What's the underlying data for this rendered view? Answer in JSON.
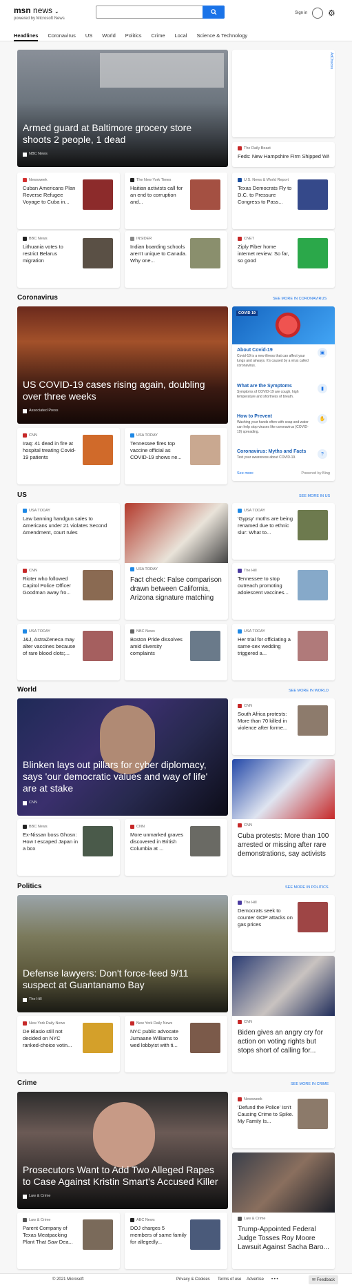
{
  "header": {
    "brand": "msn",
    "section": "news",
    "powered": "powered by Microsoft News",
    "signin": "Sign in"
  },
  "nav": [
    "Headlines",
    "Coronavirus",
    "US",
    "World",
    "Politics",
    "Crime",
    "Local",
    "Science & Technology"
  ],
  "ad": {
    "label": "AdChoices"
  },
  "hero1": {
    "title": "Armed guard at Baltimore grocery store shoots 2 people, 1 dead",
    "source": "NBC News"
  },
  "beast": {
    "source": "The Daily Beast",
    "title": "Feds: New Hampshire Firm Shipped WM..."
  },
  "row1": [
    {
      "source": "Newsweek",
      "title": "Cuban Americans Plan Reverse Refugee Voyage to Cuba in...",
      "color": "#d32f2f"
    },
    {
      "source": "The New York Times",
      "title": "Haitian activists call for an end to corruption and...",
      "color": "#222"
    },
    {
      "source": "U.S. News & World Report",
      "title": "Texas Democrats Fly to D.C. to Pressure Congress to Pass...",
      "color": "#1a4fa0"
    }
  ],
  "row2": [
    {
      "source": "BBC News",
      "title": "Lithuania votes to restrict Belarus migration",
      "color": "#222"
    },
    {
      "source": "INSIDER",
      "title": "Indian boarding schools aren't unique to Canada. Why one...",
      "color": "#888"
    },
    {
      "source": "CNET",
      "title": "Ziply Fiber home internet review: So far, so good",
      "color": "#c62828"
    }
  ],
  "corona": {
    "heading": "Coronavirus",
    "more": "SEE MORE IN CORONAVIRUS",
    "hero": {
      "title": "US COVID-19 cases rising again, doubling over three weeks",
      "source": "Associated Press"
    },
    "cards": [
      {
        "source": "CNN",
        "title": "Iraq: 41 dead in fire at hospital treating Covid-19 patients",
        "color": "#c62828"
      },
      {
        "source": "USA TODAY",
        "title": "Tennessee fires top vaccine official as COVID-19 shows ne...",
        "color": "#1e88e5"
      }
    ],
    "panel": {
      "tag": "COVID 19",
      "items": [
        {
          "h": "About Covid-19",
          "d": "Covid-19 is a new illness that can affect your lungs and airways. It's caused by a virus called coronavirus."
        },
        {
          "h": "What are the Symptoms",
          "d": "Symptoms of COVID-19 are cough, high temperature and shortness of breath."
        },
        {
          "h": "How to Prevent",
          "d": "Washing your hands often with soap and water can help stop viruses like coronavirus (COVID-19) spreading."
        },
        {
          "h": "Coronavirus: Myths and Facts",
          "d": "Test your awareness about COVID-19."
        }
      ],
      "see_more": "See more",
      "powered": "Powered by Bing"
    }
  },
  "us": {
    "heading": "US",
    "more": "SEE MORE IN US",
    "lead": {
      "source": "USA TODAY",
      "title": "Law banning handgun sales to Americans under 21 violates Second Amendment, court rules"
    },
    "center": {
      "source": "USA TODAY",
      "title": "Fact check: False comparison drawn between California, Arizona signature matching"
    },
    "moths": {
      "source": "USA TODAY",
      "title": "'Gypsy' moths are being renamed due to ethnic slur: What to..."
    },
    "capitol": {
      "source": "CNN",
      "title": "Rioter who followed Capitol Police Officer Goodman away fro..."
    },
    "hill": {
      "source": "The Hill",
      "title": "Tennessee to stop outreach promoting adolescent vaccines..."
    },
    "row": [
      {
        "source": "USA TODAY",
        "title": "J&J, AstraZeneca may alter vaccines because of rare blood clots;...",
        "color": "#1e88e5"
      },
      {
        "source": "NBC News",
        "title": "Boston Pride dissolves amid diversity complaints",
        "color": "#666"
      },
      {
        "source": "USA TODAY",
        "title": "Her trial for officiating a same-sex wedding triggered a...",
        "color": "#1e88e5"
      }
    ]
  },
  "world": {
    "heading": "World",
    "more": "SEE MORE IN WORLD",
    "hero": {
      "title": "Blinken lays out pillars for cyber diplomacy, says 'our democratic values and way of life' are at stake",
      "source": "CNN"
    },
    "sa": {
      "source": "CNN",
      "title": "South Africa protests: More than 70 killed in violence after forme..."
    },
    "cuba": {
      "source": "CNN",
      "title": "Cuba protests: More than 100 arrested or missing after rare demonstrations, say activists"
    },
    "cards": [
      {
        "source": "BBC News",
        "title": "Ex-Nissan boss Ghosn: How I escaped Japan in a box",
        "color": "#222"
      },
      {
        "source": "CNN",
        "title": "More unmarked graves discovered in British Columbia at ...",
        "color": "#c62828"
      }
    ]
  },
  "politics": {
    "heading": "Politics",
    "more": "SEE MORE IN POLITICS",
    "hero": {
      "title": "Defense lawyers: Don't force-feed 9/11 suspect at Guantanamo Bay",
      "source": "The Hill"
    },
    "gop": {
      "source": "The Hill",
      "title": "Democrats seek to counter GOP attacks on gas prices"
    },
    "biden": {
      "source": "CNN",
      "title": "Biden gives an angry cry for action on voting rights but stops short of calling for..."
    },
    "cards": [
      {
        "source": "New York Daily News",
        "title": "De Blasio still not decided on NYC ranked-choice votin...",
        "color": "#c62828"
      },
      {
        "source": "New York Daily News",
        "title": "NYC public advocate Jumaane Williams to wed lobbyist with ti...",
        "color": "#c62828"
      }
    ]
  },
  "crime": {
    "heading": "Crime",
    "more": "SEE MORE IN CRIME",
    "hero": {
      "title": "Prosecutors Want to Add Two Alleged Rapes to Case Against Kristin Smart's Accused Killer",
      "source": "Law & Crime"
    },
    "police": {
      "source": "Newsweek",
      "title": "'Defund the Police' Isn't Causing Crime to Spike. My Family Is..."
    },
    "judge": {
      "source": "Law & Crime",
      "title": "Trump-Appointed Federal Judge Tosses Roy Moore Lawsuit Against Sacha Baro..."
    },
    "cards": [
      {
        "source": "Law & Crime",
        "title": "Parent Company of Texas Meatpacking Plant That Saw Dea...",
        "color": "#555"
      },
      {
        "source": "ABC News",
        "title": "DOJ charges 5 members of same family for allegedly...",
        "color": "#222"
      }
    ]
  },
  "footer": {
    "copyright": "© 2021 Microsoft",
    "privacy": "Privacy & Cookies",
    "terms": "Terms of use",
    "advertise": "Advertise",
    "more": "• • •",
    "feedback": "Feedback"
  }
}
